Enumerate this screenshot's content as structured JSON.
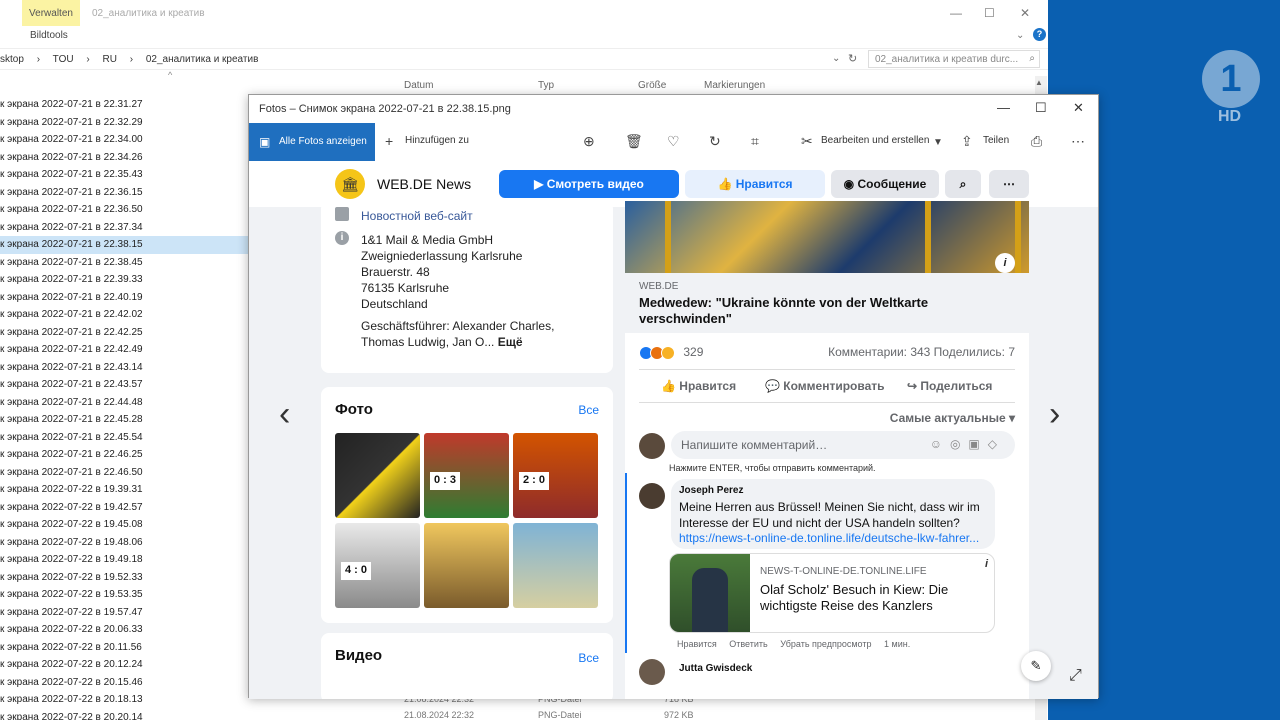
{
  "explorer": {
    "ribbon_tab": "Verwalten",
    "caption": "02_аналитика и креатив",
    "ribbon_subtab": "Bildtools",
    "controls": {
      "minimize": "—",
      "maximize": "☐",
      "close": "✕"
    },
    "breadcrumbs": [
      "sktop",
      "›",
      "TOU",
      "›",
      "RU",
      "›",
      "02_аналитика и креатив"
    ],
    "search_placeholder": "02_аналитика и креатив durc...",
    "columns": {
      "date": "Datum",
      "type": "Typ",
      "size": "Größe",
      "tags": "Markierungen"
    },
    "files": [
      "к экрана 2022-07-21 в 22.31.27",
      "к экрана 2022-07-21 в 22.32.29",
      "к экрана 2022-07-21 в 22.34.00",
      "к экрана 2022-07-21 в 22.34.26",
      "к экрана 2022-07-21 в 22.35.43",
      "к экрана 2022-07-21 в 22.36.15",
      "к экрана 2022-07-21 в 22.36.50",
      "к экрана 2022-07-21 в 22.37.34",
      "к экрана 2022-07-21 в 22.38.15",
      "к экрана 2022-07-21 в 22.38.45",
      "к экрана 2022-07-21 в 22.39.33",
      "к экрана 2022-07-21 в 22.40.19",
      "к экрана 2022-07-21 в 22.42.02",
      "к экрана 2022-07-21 в 22.42.25",
      "к экрана 2022-07-21 в 22.42.49",
      "к экрана 2022-07-21 в 22.43.14",
      "к экрана 2022-07-21 в 22.43.57",
      "к экрана 2022-07-21 в 22.44.48",
      "к экрана 2022-07-21 в 22.45.28",
      "к экрана 2022-07-21 в 22.45.54",
      "к экрана 2022-07-21 в 22.46.25",
      "к экрана 2022-07-21 в 22.46.50",
      "к экрана 2022-07-22 в 19.39.31",
      "к экрана 2022-07-22 в 19.42.57",
      "к экрана 2022-07-22 в 19.45.08",
      "к экрана 2022-07-22 в 19.48.06",
      "к экрана 2022-07-22 в 19.49.18",
      "к экрана 2022-07-22 в 19.52.33",
      "к экрана 2022-07-22 в 19.53.35",
      "к экрана 2022-07-22 в 19.57.47",
      "к экрана 2022-07-22 в 20.06.33",
      "к экрана 2022-07-22 в 20.11.56",
      "к экрана 2022-07-22 в 20.12.24",
      "к экрана 2022-07-22 в 20.15.46",
      "к экрана 2022-07-22 в 20.18.13",
      "к экрана 2022-07-22 в 20.20.14"
    ],
    "selected_index": 8,
    "bottom_rows": [
      {
        "date": "21.08.2024 22:32",
        "type": "PNG-Datei",
        "size": "718 KB"
      },
      {
        "date": "21.08.2024 22:32",
        "type": "PNG-Datei",
        "size": "972 KB"
      }
    ]
  },
  "tv_logo": {
    "mark": "1",
    "hd": "HD"
  },
  "photos": {
    "title": "Fotos – Снимок экрана 2022-07-21 в 22.38.15.png",
    "controls": {
      "minimize": "—",
      "maximize": "☐",
      "close": "✕"
    },
    "all_photos": "Alle Fotos anzeigen",
    "add_to": "Hinzufügen zu",
    "edit_create": "Bearbeiten und erstellen",
    "share": "Teilen",
    "icons": [
      "zoom-in-icon",
      "delete-icon",
      "heart-icon",
      "rotate-icon",
      "crop-icon",
      "edit-icon",
      "share-icon",
      "print-icon",
      "more-icon"
    ]
  },
  "fb": {
    "page_name": "WEB.DE News",
    "btn_video": "Смотреть видео",
    "btn_like": "Нравится",
    "btn_message": "Сообщение",
    "info": {
      "site": "Новостной веб-сайт",
      "lines": [
        "1&1 Mail & Media GmbH",
        "Zweigniederlassung Karlsruhe",
        "Brauerstr. 48",
        "76135 Karlsruhe",
        "Deutschland"
      ],
      "manager_line1": "Geschäftsführer: Alexander Charles,",
      "manager_line2": "Thomas Ludwig, Jan O...",
      "more": "Ещё"
    },
    "photos_section": {
      "title": "Фото",
      "all": "Все",
      "scores": [
        "0 : 3",
        "2 : 0",
        "4 : 0"
      ]
    },
    "video_section": {
      "title": "Видео",
      "all": "Все"
    },
    "post": {
      "source": "WEB.DE",
      "title": "Medwedew: \"Ukraine könnte von der Weltkarte verschwinden\"",
      "reactions": "329",
      "comments_shares": "Комментарии: 343  Поделились: 7",
      "like": "Нравится",
      "comment": "Комментировать",
      "share": "Поделиться",
      "sort": "Самые актуальные ▾",
      "comment_placeholder": "Напишите комментарий…",
      "enter_hint": "Нажмите ENTER, чтобы отправить комментарий."
    },
    "comment1": {
      "author": "Joseph Perez",
      "text": "Meine Herren aus Brüssel! Meinen Sie nicht, dass wir im Interesse der EU und nicht der USA handeln sollten?",
      "link": "https://news-t-online-de.tonline.life/deutsche-lkw-fahrer...",
      "preview_source": "NEWS-T-ONLINE-DE.TONLINE.LIFE",
      "preview_title": "Olaf Scholz' Besuch in Kiew: Die wichtigste Reise des Kanzlers",
      "actions": [
        "Нравится",
        "Ответить",
        "Убрать предпросмотр",
        "1 мин."
      ]
    },
    "comment2": {
      "author": "Jutta Gwisdeck"
    }
  },
  "colors": {
    "accent": "#1877f2",
    "photos_accent": "#1f6fbf",
    "desktop": "#0a5fb0",
    "ribbon_tab": "#fbf3a3"
  }
}
